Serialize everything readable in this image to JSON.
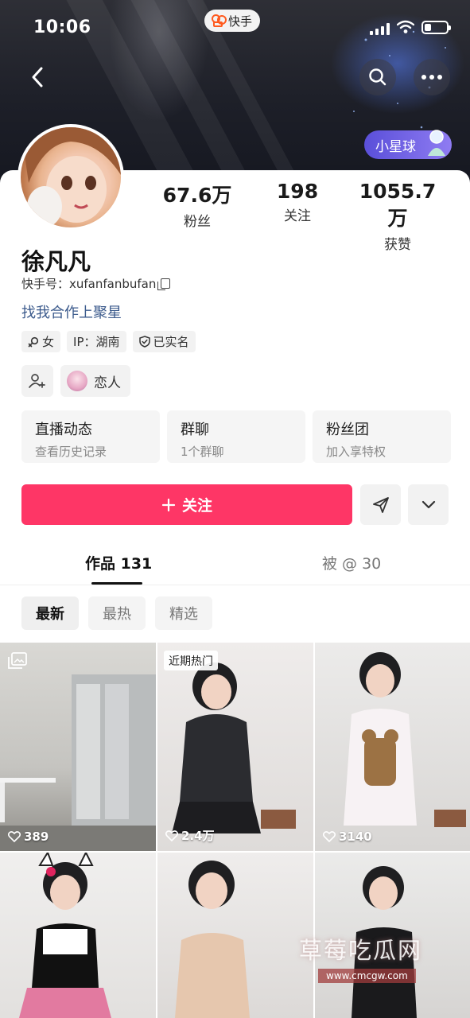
{
  "status_bar": {
    "time": "10:06",
    "app_name": "快手"
  },
  "header": {
    "planet_label": "小星球"
  },
  "profile": {
    "name": "徐凡凡",
    "kuaishou_id_label": "快手号：xufanfanbufan",
    "bio": "找我合作上聚星",
    "stats": [
      {
        "value": "67.6万",
        "label": "粉丝"
      },
      {
        "value": "198",
        "label": "关注"
      },
      {
        "value": "1055.7万",
        "label": "获赞"
      }
    ],
    "tags": [
      {
        "icon": "female-icon",
        "label": "女"
      },
      {
        "icon": "",
        "label": "IP：湖南"
      },
      {
        "icon": "verified-shield-icon",
        "label": "已实名"
      }
    ],
    "relation_label": "恋人"
  },
  "features": [
    {
      "title": "直播动态",
      "subtitle": "查看历史记录"
    },
    {
      "title": "群聊",
      "subtitle": "1个群聊"
    },
    {
      "title": "粉丝团",
      "subtitle": "加入享特权"
    }
  ],
  "actions": {
    "follow_label": "关注"
  },
  "tabs": [
    {
      "label": "作品 131",
      "active": true
    },
    {
      "label": "被 @ 30",
      "active": false
    }
  ],
  "filters": [
    {
      "label": "最新",
      "active": true
    },
    {
      "label": "最热",
      "active": false
    },
    {
      "label": "精选",
      "active": false
    }
  ],
  "grid": [
    {
      "likes": "389",
      "badge": "",
      "gallery": true
    },
    {
      "likes": "2.4万",
      "badge": "近期热门",
      "gallery": false
    },
    {
      "likes": "3140",
      "badge": "",
      "gallery": false
    },
    {
      "likes": "",
      "badge": "",
      "gallery": false
    },
    {
      "likes": "",
      "badge": "",
      "gallery": false
    },
    {
      "likes": "",
      "badge": "",
      "gallery": false
    }
  ],
  "watermark": {
    "title": "草莓吃瓜网",
    "url": "www.cmcgw.com"
  },
  "colors": {
    "follow": "#fe3666",
    "bio_link": "#3b5a8c",
    "planet": "#6a5de0"
  }
}
